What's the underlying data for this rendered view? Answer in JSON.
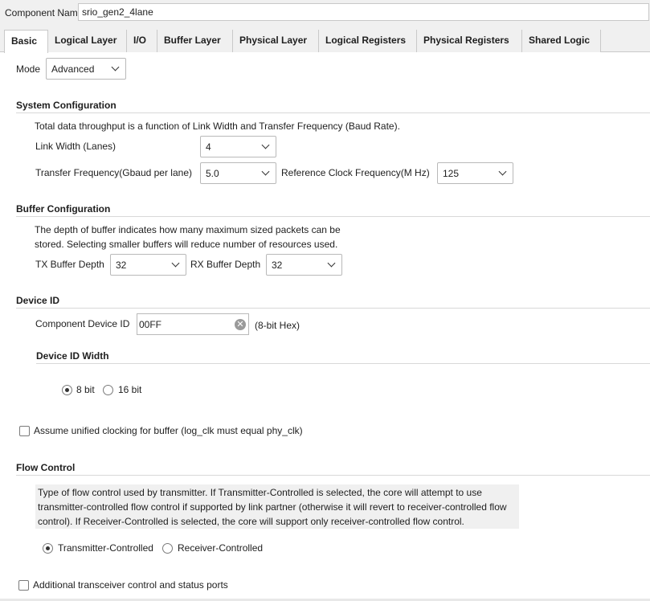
{
  "header": {
    "component_name_label": "Component Name",
    "component_name_value": "srio_gen2_4lane"
  },
  "tabs": [
    {
      "label": "Basic",
      "active": true
    },
    {
      "label": "Logical Layer"
    },
    {
      "label": "I/O"
    },
    {
      "label": "Buffer Layer"
    },
    {
      "label": "Physical Layer"
    },
    {
      "label": "Logical Registers"
    },
    {
      "label": "Physical Registers"
    },
    {
      "label": "Shared Logic"
    }
  ],
  "mode": {
    "label": "Mode",
    "value": "Advanced"
  },
  "system_config": {
    "heading": "System Configuration",
    "description": "Total data throughput is a function of Link Width and Transfer Frequency (Baud Rate).",
    "link_width_label": "Link Width (Lanes)",
    "link_width_value": "4",
    "transfer_freq_label": "Transfer Frequency(Gbaud per lane)",
    "transfer_freq_value": "5.0",
    "ref_clock_label": "Reference Clock Frequency(M Hz)",
    "ref_clock_value": "125"
  },
  "buffer_config": {
    "heading": "Buffer Configuration",
    "description_line1": "The depth of buffer indicates how many maximum sized packets can be",
    "description_line2": "stored. Selecting smaller buffers will reduce number of resources used.",
    "tx_label": "TX Buffer Depth",
    "tx_value": "32",
    "rx_label": "RX Buffer Depth",
    "rx_value": "32"
  },
  "device_id": {
    "heading": "Device ID",
    "component_device_id_label": "Component Device ID",
    "component_device_id_value": "00FF",
    "hex_note": "(8-bit Hex)",
    "width_heading": "Device ID Width",
    "option_8": "8 bit",
    "option_16": "16 bit",
    "selected": "8 bit"
  },
  "unified_clocking": {
    "label": "Assume unified clocking for buffer (log_clk must equal phy_clk)",
    "checked": false
  },
  "flow_control": {
    "heading": "Flow Control",
    "desc_line1": "Type of flow control used by transmitter. If Transmitter-Controlled is selected, the core will attempt to use",
    "desc_line2": "transmitter-controlled flow control if supported by link partner (otherwise it will revert to receiver-controlled flow",
    "desc_line3": "control). If Receiver-Controlled is selected, the core will support only receiver-controlled flow control.",
    "option_tx": "Transmitter-Controlled",
    "option_rx": "Receiver-Controlled",
    "selected": "Transmitter-Controlled"
  },
  "transceiver_ports": {
    "label": "Additional transceiver control and status ports",
    "checked": false
  }
}
